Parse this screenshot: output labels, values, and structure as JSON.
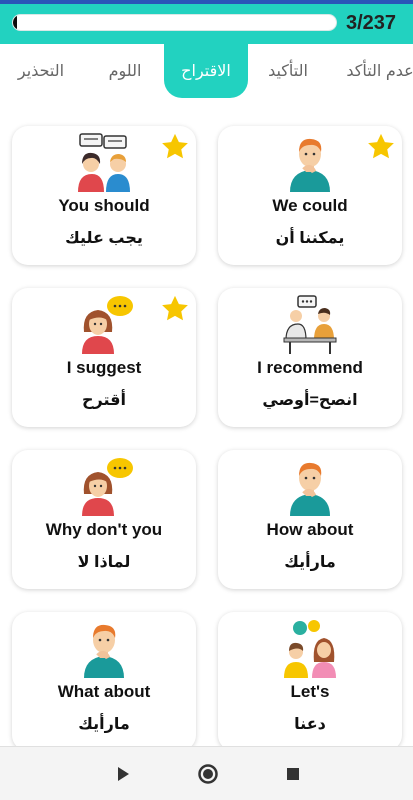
{
  "progress": {
    "label": "3/237",
    "fraction": 0.0127
  },
  "tabs": [
    {
      "label": "عدم التأكد",
      "active": false
    },
    {
      "label": "التأكيد",
      "active": false
    },
    {
      "label": "الاقتراح",
      "active": true
    },
    {
      "label": "اللوم",
      "active": false
    },
    {
      "label": "التحذير",
      "active": false
    }
  ],
  "cards": [
    {
      "en": "We could",
      "ar": "يمكننا أن",
      "starred": true,
      "icon": "thinking-man-icon"
    },
    {
      "en": "You should",
      "ar": "يجب عليك",
      "starred": true,
      "icon": "two-people-talking-icon"
    },
    {
      "en": "I recommend",
      "ar": "انصح=أوصي",
      "starred": false,
      "icon": "meeting-desk-icon"
    },
    {
      "en": "I suggest",
      "ar": "أقترح",
      "starred": true,
      "icon": "thinking-woman-icon"
    },
    {
      "en": "How about",
      "ar": "مارأيك",
      "starred": false,
      "icon": "thinking-man-icon"
    },
    {
      "en": "Why don't you",
      "ar": "لماذا لا",
      "starred": false,
      "icon": "thinking-woman-icon"
    },
    {
      "en": "Let's",
      "ar": "دعنا",
      "starred": false,
      "icon": "two-people-chatting-icon"
    },
    {
      "en": "What about",
      "ar": "مارأيك",
      "starred": false,
      "icon": "thinking-man-icon"
    }
  ],
  "nav": {
    "back": "triangle-back-icon",
    "home": "circle-home-icon",
    "recents": "square-recents-icon"
  },
  "colors": {
    "accent": "#22d2c0",
    "status": "#2a55b8",
    "star": "#f7c600"
  }
}
